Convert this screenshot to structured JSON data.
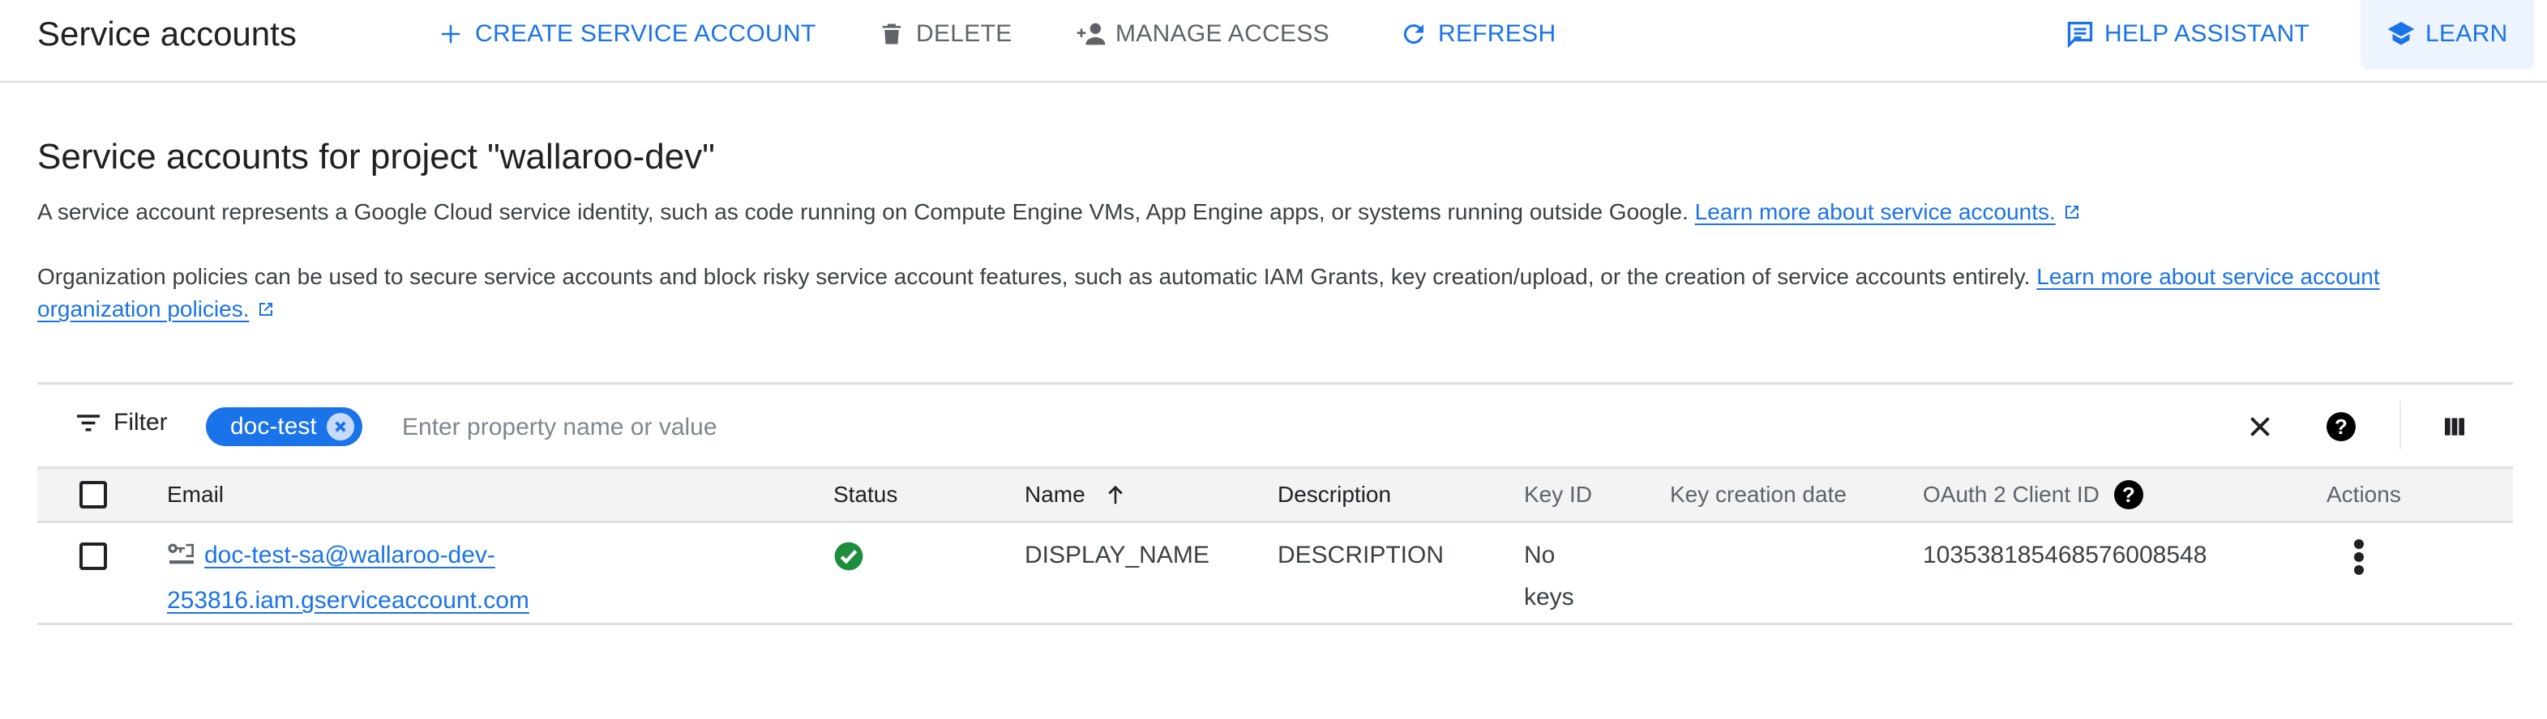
{
  "header": {
    "title": "Service accounts",
    "actions": {
      "create": "CREATE SERVICE ACCOUNT",
      "delete": "DELETE",
      "manage_access": "MANAGE ACCESS",
      "refresh": "REFRESH",
      "help_assistant": "HELP ASSISTANT",
      "learn": "LEARN"
    }
  },
  "main": {
    "heading": "Service accounts for project \"wallaroo-dev\"",
    "intro": {
      "text": "A service account represents a Google Cloud service identity, such as code running on Compute Engine VMs, App Engine apps, or systems running outside Google. ",
      "link": "Learn more about service accounts."
    },
    "policies": {
      "text": "Organization policies can be used to secure service accounts and block risky service account features, such as automatic IAM Grants, key creation/upload, or the creation of service accounts entirely. ",
      "link": "Learn more about service account organization policies."
    }
  },
  "filter": {
    "label": "Filter",
    "chip": "doc-test",
    "placeholder": "Enter property name or value"
  },
  "table": {
    "columns": {
      "email": "Email",
      "status": "Status",
      "name": "Name",
      "description": "Description",
      "key_id": "Key ID",
      "key_creation_date": "Key creation date",
      "oauth_client_id": "OAuth 2 Client ID",
      "actions": "Actions"
    },
    "sort": {
      "column": "Name",
      "direction": "ascending"
    },
    "rows": [
      {
        "email_line1": "doc-test-sa@wallaroo-dev-",
        "email_line2": "253816.iam.gserviceaccount.com",
        "status": "enabled",
        "name": "DISPLAY_NAME",
        "description": "DESCRIPTION",
        "key_id_line1": "No",
        "key_id_line2": "keys",
        "key_creation_date": "",
        "oauth_client_id": "103538185468576008548"
      }
    ]
  },
  "colors": {
    "accent": "#1a73e8",
    "status_ok": "#1e8e3e"
  }
}
